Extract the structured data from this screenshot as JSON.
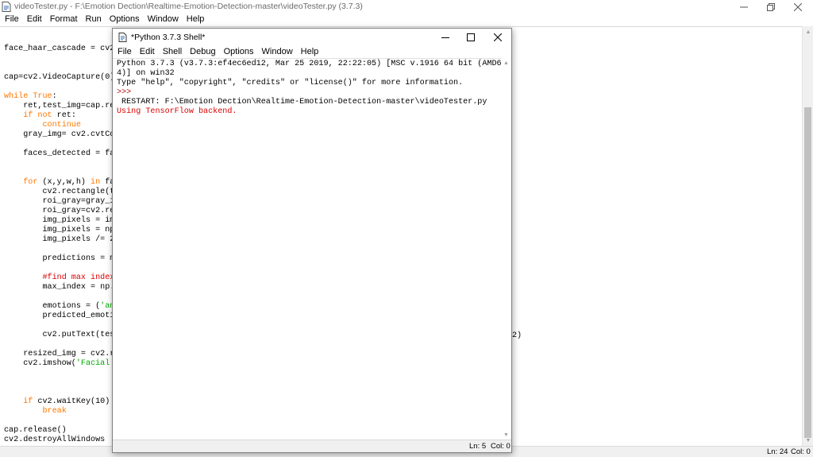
{
  "main_window": {
    "title": "videoTester.py - F:\\Emotion Dection\\Realtime-Emotion-Detection-master\\videoTester.py (3.7.3)",
    "menu": [
      "File",
      "Edit",
      "Format",
      "Run",
      "Options",
      "Window",
      "Help"
    ],
    "code_lines": [
      "face_haar_cascade = cv2",
      "",
      "",
      "cap=cv2.VideoCapture(0)",
      "",
      "while True:",
      "    ret,test_img=cap.re",
      "    if not ret:",
      "        continue",
      "    gray_img= cv2.cvtCo",
      "",
      "    faces_detected = fa",
      "",
      "",
      "    for (x,y,w,h) in fa",
      "        cv2.rectangle(t",
      "        roi_gray=gray_i",
      "        roi_gray=cv2.re",
      "        img_pixels = im",
      "        img_pixels = np",
      "        img_pixels /= 2",
      "",
      "        predictions = m",
      "",
      "        #find max index",
      "        max_index = np.",
      "",
      "        emotions = ('an",
      "        predicted_emoti",
      "",
      "        cv2.putText(tes",
      "",
      "    resized_img = cv2.r",
      "    cv2.imshow('Facial",
      "",
      "",
      "",
      "    if cv2.waitKey(10)",
      "        break",
      "",
      "cap.release()",
      "cv2.destroyAllWindows"
    ],
    "overflow_text": "2)",
    "status": {
      "line": "Ln: 24",
      "col": "Col: 0"
    }
  },
  "shell_window": {
    "title": "*Python 3.7.3 Shell*",
    "menu": [
      "File",
      "Edit",
      "Shell",
      "Debug",
      "Options",
      "Window",
      "Help"
    ],
    "output": {
      "banner1": "Python 3.7.3 (v3.7.3:ef4ec6ed12, Mar 25 2019, 22:22:05) [MSC v.1916 64 bit (AMD6",
      "banner2": "4)] on win32",
      "banner3": "Type \"help\", \"copyright\", \"credits\" or \"license()\" for more information.",
      "prompt": ">>> ",
      "restart": " RESTART: F:\\Emotion Dection\\Realtime-Emotion-Detection-master\\videoTester.py",
      "tensorflow": "Using TensorFlow backend."
    },
    "status": {
      "line": "Ln: 5",
      "col": "Col: 0"
    }
  },
  "colors": {
    "keyword": "#ff7700",
    "string": "#00aa00",
    "comment": "#dd0000",
    "error": "#dd0000"
  }
}
